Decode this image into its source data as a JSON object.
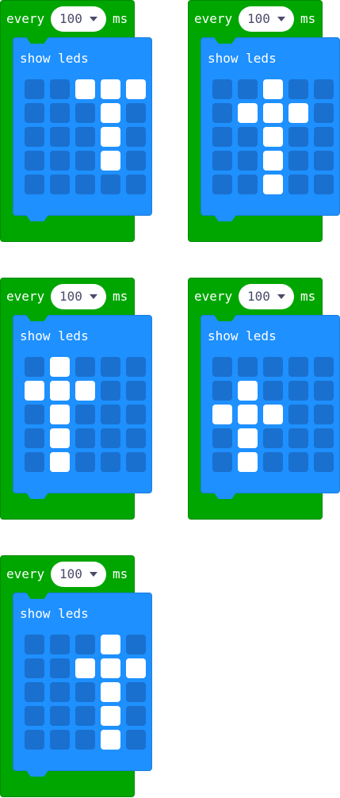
{
  "blocks": [
    {
      "event": "every",
      "interval": "100",
      "unit": "ms",
      "body": "show leds",
      "leds": [
        [
          0,
          0,
          1,
          1,
          1
        ],
        [
          0,
          0,
          0,
          1,
          0
        ],
        [
          0,
          0,
          0,
          1,
          0
        ],
        [
          0,
          0,
          0,
          1,
          0
        ],
        [
          0,
          0,
          0,
          0,
          0
        ]
      ]
    },
    {
      "event": "every",
      "interval": "100",
      "unit": "ms",
      "body": "show leds",
      "leds": [
        [
          0,
          0,
          1,
          0,
          0
        ],
        [
          0,
          1,
          1,
          1,
          0
        ],
        [
          0,
          0,
          1,
          0,
          0
        ],
        [
          0,
          0,
          1,
          0,
          0
        ],
        [
          0,
          0,
          1,
          0,
          0
        ]
      ]
    },
    {
      "event": "every",
      "interval": "100",
      "unit": "ms",
      "body": "show leds",
      "leds": [
        [
          0,
          1,
          0,
          0,
          0
        ],
        [
          1,
          1,
          1,
          0,
          0
        ],
        [
          0,
          1,
          0,
          0,
          0
        ],
        [
          0,
          1,
          0,
          0,
          0
        ],
        [
          0,
          1,
          0,
          0,
          0
        ]
      ]
    },
    {
      "event": "every",
      "interval": "100",
      "unit": "ms",
      "body": "show leds",
      "leds": [
        [
          0,
          0,
          0,
          0,
          0
        ],
        [
          0,
          1,
          0,
          0,
          0
        ],
        [
          1,
          1,
          1,
          0,
          0
        ],
        [
          0,
          1,
          0,
          0,
          0
        ],
        [
          0,
          1,
          0,
          0,
          0
        ]
      ]
    },
    {
      "event": "every",
      "interval": "100",
      "unit": "ms",
      "body": "show leds",
      "leds": [
        [
          0,
          0,
          0,
          1,
          0
        ],
        [
          0,
          0,
          1,
          1,
          1
        ],
        [
          0,
          0,
          0,
          1,
          0
        ],
        [
          0,
          0,
          0,
          1,
          0
        ],
        [
          0,
          0,
          0,
          1,
          0
        ]
      ]
    }
  ],
  "colors": {
    "event_block": "#00a600",
    "basic_block": "#1e90ff",
    "led_off": "#1a70cf",
    "led_on": "#ffffff"
  }
}
